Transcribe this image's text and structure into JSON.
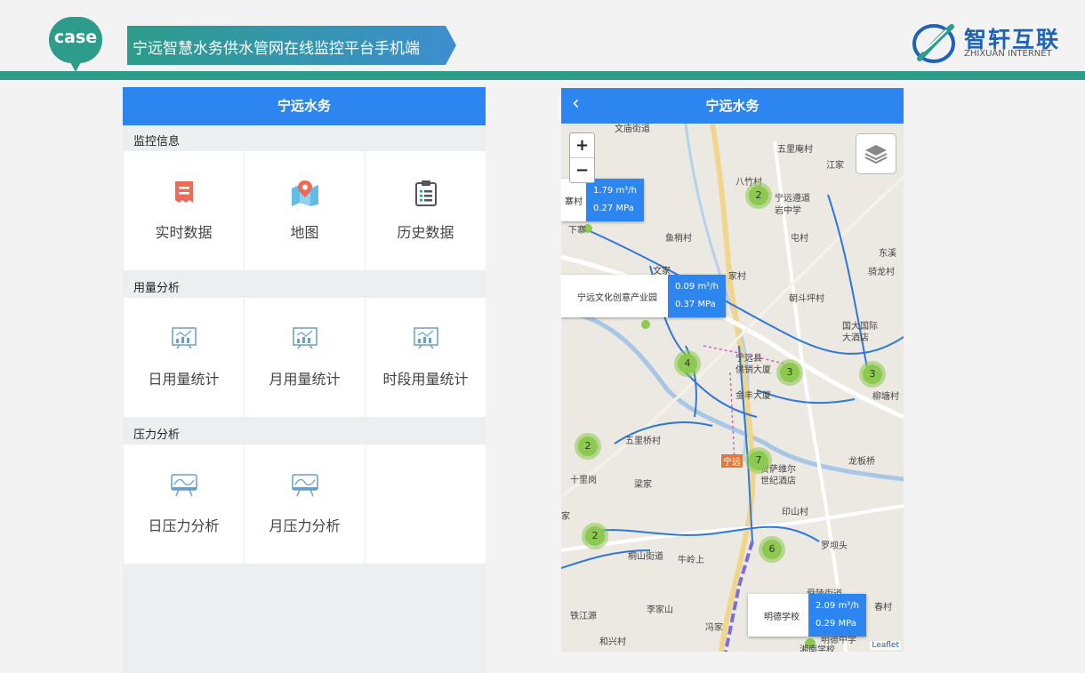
{
  "slide": {
    "case_badge": "case",
    "title": "宁远智慧水务供水管网在线监控平台手机端",
    "brand_cn": "智轩互联",
    "brand_en": "ZHIXUAN INTERNET",
    "accent_color": "#2d9c8a",
    "brand_color": "#1e63b8"
  },
  "left_phone": {
    "app_title": "宁远水务",
    "sections": [
      {
        "label": "监控信息",
        "items": [
          {
            "label": "实时数据",
            "icon": "receipt-icon"
          },
          {
            "label": "地图",
            "icon": "map-pin-icon"
          },
          {
            "label": "历史数据",
            "icon": "clipboard-icon"
          }
        ]
      },
      {
        "label": "用量分析",
        "items": [
          {
            "label": "日用量统计",
            "icon": "bar-chart-icon"
          },
          {
            "label": "月用量统计",
            "icon": "bar-chart-icon"
          },
          {
            "label": "时段用量统计",
            "icon": "bar-chart-icon"
          }
        ]
      },
      {
        "label": "压力分析",
        "items": [
          {
            "label": "日压力分析",
            "icon": "pressure-chart-icon"
          },
          {
            "label": "月压力分析",
            "icon": "pressure-chart-icon"
          }
        ]
      }
    ]
  },
  "right_phone": {
    "app_title": "宁远水务",
    "zoom_in": "+",
    "zoom_out": "−",
    "attribution": "Leaflet",
    "popups": [
      {
        "name": "寨村",
        "flow": "1.79 m³/h",
        "pressure": "0.27 MPa"
      },
      {
        "name": "宁远文化创意产业园",
        "flow": "0.09 m³/h",
        "pressure": "0.37 MPa"
      },
      {
        "name": "明德学校",
        "flow": "2.09 m³/h",
        "pressure": "0.29 MPa"
      }
    ],
    "clusters": [
      "2",
      "4",
      "3",
      "3",
      "2",
      "7",
      "2",
      "6"
    ],
    "places": [
      "文庙街道",
      "五里庵村",
      "江家",
      "八竹村",
      "宁远遵道",
      "岩中学",
      "下寨",
      "鱼梢村",
      "屯村",
      "东溪",
      "骑龙村",
      "文家",
      "家村",
      "朝斗坪村",
      "国大国际",
      "大酒店",
      "宁远县",
      "供销大厦",
      "金丰大厦",
      "柳塘村",
      "五里桥村",
      "宁远",
      "贺萨维尔",
      "世纪酒店",
      "龙板桥",
      "十里岗",
      "梁家",
      "印山村",
      "家",
      "罗坝头",
      "桐山街道",
      "牛岭上",
      "舜陵街道",
      "春村",
      "铁江源",
      "李家山",
      "冯家",
      "和兴村",
      "明德中学",
      "湘南学校"
    ]
  }
}
